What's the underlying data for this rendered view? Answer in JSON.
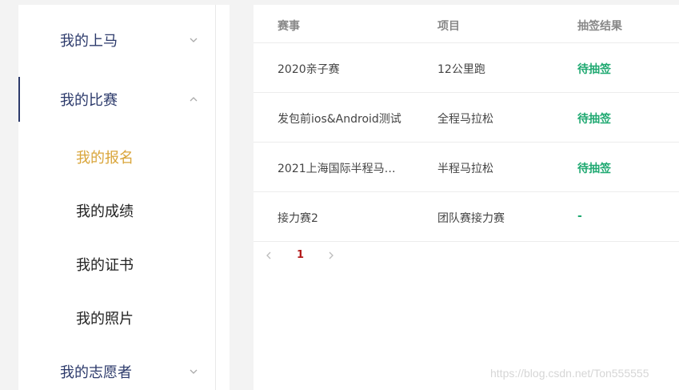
{
  "sidebar": {
    "items": [
      {
        "label": "我的上马",
        "expanded": false
      },
      {
        "label": "我的比赛",
        "expanded": true,
        "children": [
          {
            "label": "我的报名",
            "selected": true
          },
          {
            "label": "我的成绩",
            "selected": false
          },
          {
            "label": "我的证书",
            "selected": false
          },
          {
            "label": "我的照片",
            "selected": false
          }
        ]
      },
      {
        "label": "我的志愿者",
        "expanded": false
      }
    ]
  },
  "table": {
    "headers": [
      "赛事",
      "项目",
      "抽签结果"
    ],
    "rows": [
      {
        "event": "2020亲子赛",
        "item": "12公里跑",
        "result": "待抽签"
      },
      {
        "event": "发包前ios&Android测试",
        "item": "全程马拉松",
        "result": "待抽签"
      },
      {
        "event": "2021上海国际半程马拉...",
        "item": "半程马拉松",
        "result": "待抽签"
      },
      {
        "event": "接力赛2",
        "item": "团队赛接力赛",
        "result": "-"
      }
    ]
  },
  "pagination": {
    "current_page": "1"
  },
  "watermark": "https://blog.csdn.net/Ton555555",
  "colors": {
    "accent_nav": "#2c3a6b",
    "selected_sub": "#d9a53a",
    "status_green": "#1fa971",
    "page_active": "#b31b1b"
  }
}
